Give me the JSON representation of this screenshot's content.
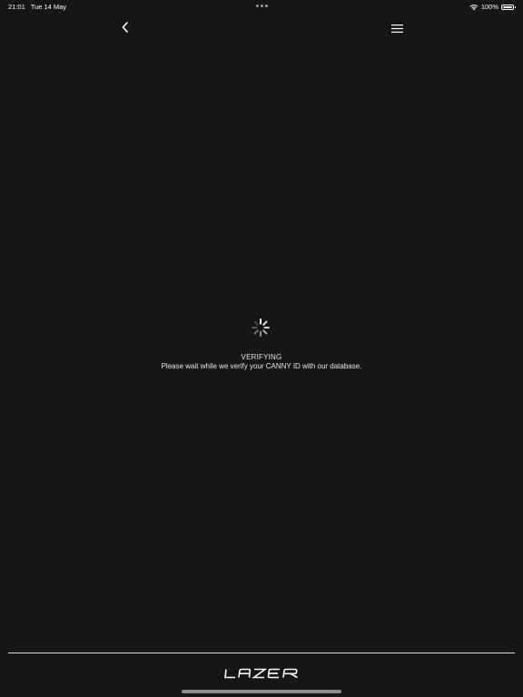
{
  "status_bar": {
    "time": "21:01",
    "date": "Tue 14 May",
    "battery": "100%",
    "battery_level": 1.0,
    "wifi_icon": "wifi-icon",
    "battery_icon": "battery-icon"
  },
  "nav": {
    "back_icon": "chevron-left-icon",
    "menu_icon": "hamburger-menu-icon"
  },
  "loading": {
    "icon": "spinner-icon",
    "title": "VERIFYING",
    "message": "Please wait while we verify your CANNY ID with our database."
  },
  "footer": {
    "logo_text": "LAZER"
  },
  "colors": {
    "background": "#161616",
    "text": "#ffffff",
    "divider": "#d8d8d8"
  }
}
